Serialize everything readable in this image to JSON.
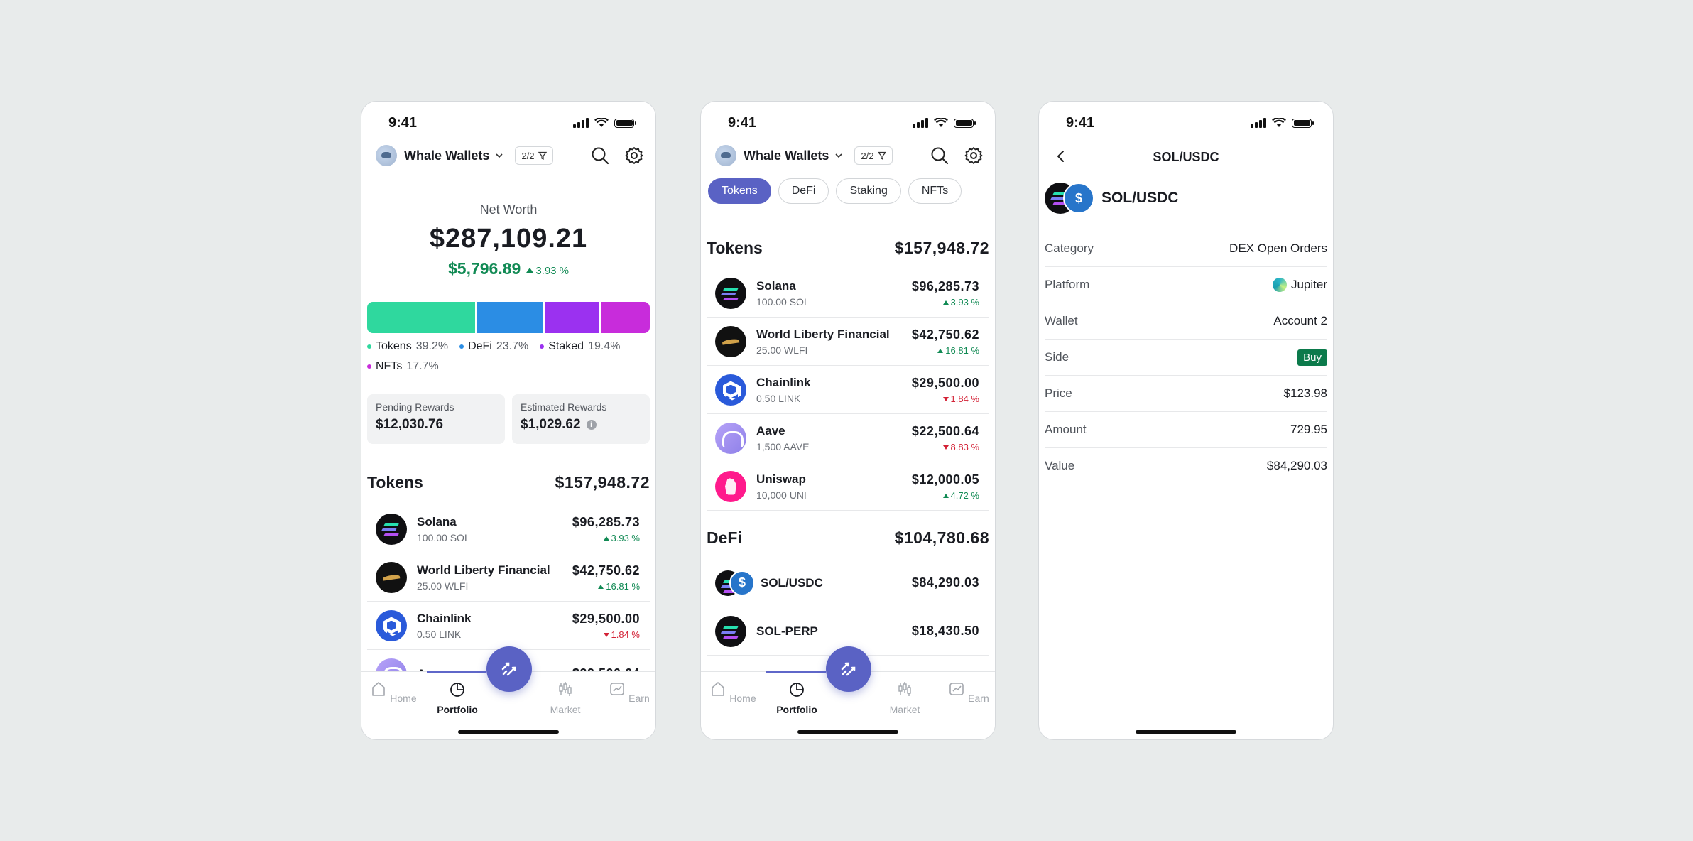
{
  "status": {
    "time": "9:41"
  },
  "header": {
    "wallet_name": "Whale Wallets",
    "filter_count": "2/2"
  },
  "net_worth": {
    "label": "Net Worth",
    "value": "$287,109.21",
    "change_amount": "$5,796.89",
    "change_pct": "3.93 %"
  },
  "allocation": [
    {
      "label": "Tokens",
      "pct": "39.2%",
      "fraction": 0.392,
      "color": "#2fd89e"
    },
    {
      "label": "DeFi",
      "pct": "23.7%",
      "fraction": 0.237,
      "color": "#2b8de4"
    },
    {
      "label": "Staked",
      "pct": "19.4%",
      "fraction": 0.194,
      "color": "#9b31f0"
    },
    {
      "label": "NFTs",
      "pct": "17.7%",
      "fraction": 0.177,
      "color": "#c82cdb"
    }
  ],
  "rewards": {
    "pending_label": "Pending Rewards",
    "pending_value": "$12,030.76",
    "estimated_label": "Estimated Rewards",
    "estimated_value": "$1,029.62"
  },
  "tokens_section": {
    "title": "Tokens",
    "total": "$157,948.72"
  },
  "tokens": [
    {
      "name": "Solana",
      "amount": "100.00 SOL",
      "value": "$96,285.73",
      "change": "3.93 %",
      "direction": "up",
      "icon": "solana-icon"
    },
    {
      "name": "World Liberty Financial",
      "amount": "25.00 WLFI",
      "value": "$42,750.62",
      "change": "16.81 %",
      "direction": "up",
      "icon": "wlfi-icon"
    },
    {
      "name": "Chainlink",
      "amount": "0.50 LINK",
      "value": "$29,500.00",
      "change": "1.84 %",
      "direction": "down",
      "icon": "chainlink-icon"
    },
    {
      "name": "Aave",
      "amount": "1,500 AAVE",
      "value": "$22,500.64",
      "change": "8.83 %",
      "direction": "down",
      "icon": "aave-icon"
    },
    {
      "name": "Uniswap",
      "amount": "10,000 UNI",
      "value": "$12,000.05",
      "change": "4.72 %",
      "direction": "up",
      "icon": "uniswap-icon"
    }
  ],
  "tabs": [
    "Tokens",
    "DeFi",
    "Staking",
    "NFTs"
  ],
  "defi_section": {
    "title": "DeFi",
    "total": "$104,780.68"
  },
  "defi": [
    {
      "name": "SOL/USDC",
      "value": "$84,290.03"
    },
    {
      "name": "SOL-PERP",
      "value": "$18,430.50"
    }
  ],
  "nav": {
    "home": "Home",
    "portfolio": "Portfolio",
    "market": "Market",
    "earn": "Earn"
  },
  "detail": {
    "title": "SOL/USDC",
    "pair_name": "SOL/USDC",
    "rows": [
      {
        "key": "Category",
        "value": "DEX Open Orders"
      },
      {
        "key": "Platform",
        "value": "Jupiter"
      },
      {
        "key": "Wallet",
        "value": "Account 2"
      },
      {
        "key": "Side",
        "value": "Buy"
      },
      {
        "key": "Price",
        "value": "$123.98"
      },
      {
        "key": "Amount",
        "value": "729.95"
      },
      {
        "key": "Value",
        "value": "$84,290.03"
      }
    ]
  }
}
